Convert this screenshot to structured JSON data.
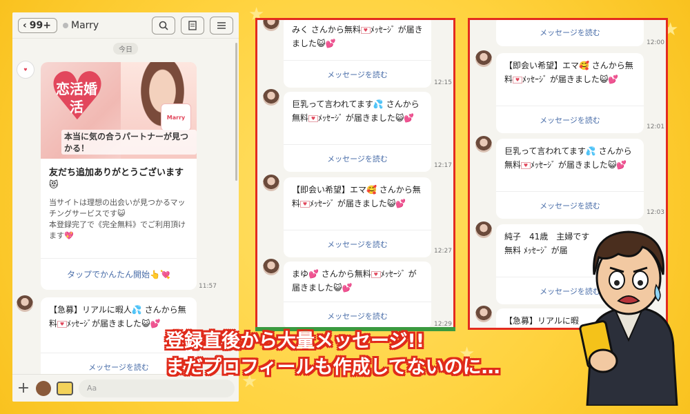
{
  "phone": {
    "back_count": "99+",
    "title": "Marry",
    "date_label": "今日",
    "card": {
      "banner_heading": "恋活婚活",
      "banner_logo": "Marry",
      "banner_tagline": "本当に気の合うパートナーが見つかる！",
      "title": "友だち追加ありがとうございます😻",
      "body_1": "当サイトは理想の出会いが見つかるマッチングサービスです😺",
      "body_2": "本登録完了で《完全無料》でご利用頂けます💖",
      "action": "タップでかんたん開始👆💘",
      "time": "11:57"
    },
    "message": {
      "text_1": "【急募】リアルに暇人💦 さんから無料",
      "text_2": "ﾒｯｾｰｼﾞが届きました😺💕",
      "action": "メッセージを読む"
    },
    "input_placeholder": "Aa"
  },
  "panel_middle": {
    "items": [
      {
        "text_1": "みく さんから無料",
        "text_2": "ﾒｯｾｰｼﾞ が届きました😺💕",
        "action": "メッセージを読む",
        "time": "12:15"
      },
      {
        "text_1": "巨乳って言われてます💦 さんから無料",
        "text_2": "ﾒｯｾｰｼﾞ が届きました😺💕",
        "action": "メッセージを読む",
        "time": "12:17"
      },
      {
        "text_1": "【即会い希望】エマ🥰 さんから無料",
        "text_2": "ﾒｯｾｰｼﾞ が届きました😺💕",
        "action": "メッセージを読む",
        "time": "12:27"
      },
      {
        "text_1": "まゆ💕 さんから無料",
        "text_2": "ﾒｯｾｰｼﾞ が届きました😺💕",
        "action": "メッセージを読む",
        "time": "12:29"
      }
    ]
  },
  "panel_right": {
    "items": [
      {
        "text_1": "",
        "text_2": "",
        "action": "メッセージを読む",
        "time": "12:00"
      },
      {
        "text_1": "【即会い希望】エマ🥰 さんから無料",
        "text_2": "ﾒｯｾｰｼﾞ が届きました😺💕",
        "action": "メッセージを読む",
        "time": "12:01"
      },
      {
        "text_1": "巨乳って言われてます💦 さんから無料",
        "text_2": "ﾒｯｾｰｼﾞ が届きました😺💕",
        "action": "メッセージを読む",
        "time": "12:03"
      },
      {
        "text_1": "純子　41歳　主婦です",
        "text_2": "無料 ﾒｯｾｰｼﾞ が届",
        "action": "メッセージを読む",
        "time": ""
      },
      {
        "text_1": "【急募】リアルに暇",
        "text_2": "",
        "action": "",
        "time": ""
      }
    ]
  },
  "caption": {
    "line_1": "登録直後から大量メッセージ!!",
    "line_2": "まだプロフィールも作成してないのに…"
  }
}
